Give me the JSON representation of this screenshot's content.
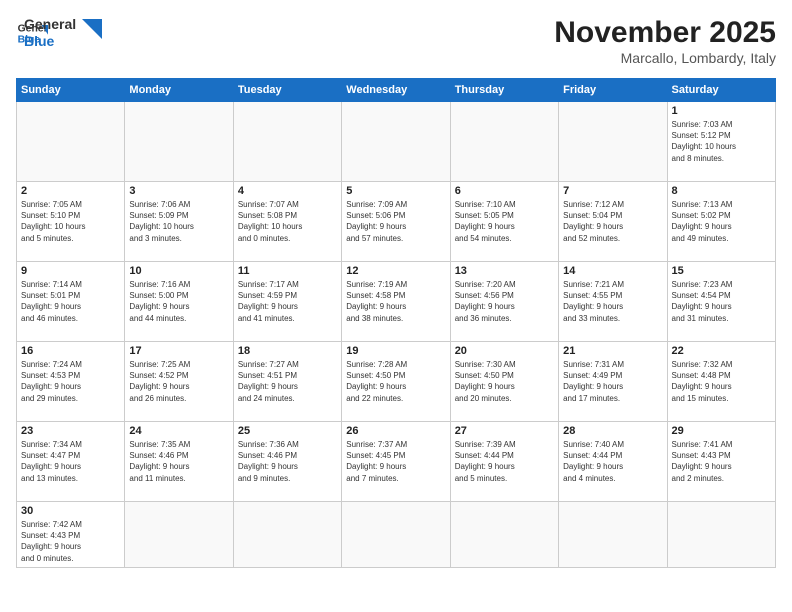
{
  "header": {
    "logo_general": "General",
    "logo_blue": "Blue",
    "month": "November 2025",
    "location": "Marcallo, Lombardy, Italy"
  },
  "weekdays": [
    "Sunday",
    "Monday",
    "Tuesday",
    "Wednesday",
    "Thursday",
    "Friday",
    "Saturday"
  ],
  "weeks": [
    [
      {
        "day": "",
        "info": ""
      },
      {
        "day": "",
        "info": ""
      },
      {
        "day": "",
        "info": ""
      },
      {
        "day": "",
        "info": ""
      },
      {
        "day": "",
        "info": ""
      },
      {
        "day": "",
        "info": ""
      },
      {
        "day": "1",
        "info": "Sunrise: 7:03 AM\nSunset: 5:12 PM\nDaylight: 10 hours\nand 8 minutes."
      }
    ],
    [
      {
        "day": "2",
        "info": "Sunrise: 7:05 AM\nSunset: 5:10 PM\nDaylight: 10 hours\nand 5 minutes."
      },
      {
        "day": "3",
        "info": "Sunrise: 7:06 AM\nSunset: 5:09 PM\nDaylight: 10 hours\nand 3 minutes."
      },
      {
        "day": "4",
        "info": "Sunrise: 7:07 AM\nSunset: 5:08 PM\nDaylight: 10 hours\nand 0 minutes."
      },
      {
        "day": "5",
        "info": "Sunrise: 7:09 AM\nSunset: 5:06 PM\nDaylight: 9 hours\nand 57 minutes."
      },
      {
        "day": "6",
        "info": "Sunrise: 7:10 AM\nSunset: 5:05 PM\nDaylight: 9 hours\nand 54 minutes."
      },
      {
        "day": "7",
        "info": "Sunrise: 7:12 AM\nSunset: 5:04 PM\nDaylight: 9 hours\nand 52 minutes."
      },
      {
        "day": "8",
        "info": "Sunrise: 7:13 AM\nSunset: 5:02 PM\nDaylight: 9 hours\nand 49 minutes."
      }
    ],
    [
      {
        "day": "9",
        "info": "Sunrise: 7:14 AM\nSunset: 5:01 PM\nDaylight: 9 hours\nand 46 minutes."
      },
      {
        "day": "10",
        "info": "Sunrise: 7:16 AM\nSunset: 5:00 PM\nDaylight: 9 hours\nand 44 minutes."
      },
      {
        "day": "11",
        "info": "Sunrise: 7:17 AM\nSunset: 4:59 PM\nDaylight: 9 hours\nand 41 minutes."
      },
      {
        "day": "12",
        "info": "Sunrise: 7:19 AM\nSunset: 4:58 PM\nDaylight: 9 hours\nand 38 minutes."
      },
      {
        "day": "13",
        "info": "Sunrise: 7:20 AM\nSunset: 4:56 PM\nDaylight: 9 hours\nand 36 minutes."
      },
      {
        "day": "14",
        "info": "Sunrise: 7:21 AM\nSunset: 4:55 PM\nDaylight: 9 hours\nand 33 minutes."
      },
      {
        "day": "15",
        "info": "Sunrise: 7:23 AM\nSunset: 4:54 PM\nDaylight: 9 hours\nand 31 minutes."
      }
    ],
    [
      {
        "day": "16",
        "info": "Sunrise: 7:24 AM\nSunset: 4:53 PM\nDaylight: 9 hours\nand 29 minutes."
      },
      {
        "day": "17",
        "info": "Sunrise: 7:25 AM\nSunset: 4:52 PM\nDaylight: 9 hours\nand 26 minutes."
      },
      {
        "day": "18",
        "info": "Sunrise: 7:27 AM\nSunset: 4:51 PM\nDaylight: 9 hours\nand 24 minutes."
      },
      {
        "day": "19",
        "info": "Sunrise: 7:28 AM\nSunset: 4:50 PM\nDaylight: 9 hours\nand 22 minutes."
      },
      {
        "day": "20",
        "info": "Sunrise: 7:30 AM\nSunset: 4:50 PM\nDaylight: 9 hours\nand 20 minutes."
      },
      {
        "day": "21",
        "info": "Sunrise: 7:31 AM\nSunset: 4:49 PM\nDaylight: 9 hours\nand 17 minutes."
      },
      {
        "day": "22",
        "info": "Sunrise: 7:32 AM\nSunset: 4:48 PM\nDaylight: 9 hours\nand 15 minutes."
      }
    ],
    [
      {
        "day": "23",
        "info": "Sunrise: 7:34 AM\nSunset: 4:47 PM\nDaylight: 9 hours\nand 13 minutes."
      },
      {
        "day": "24",
        "info": "Sunrise: 7:35 AM\nSunset: 4:46 PM\nDaylight: 9 hours\nand 11 minutes."
      },
      {
        "day": "25",
        "info": "Sunrise: 7:36 AM\nSunset: 4:46 PM\nDaylight: 9 hours\nand 9 minutes."
      },
      {
        "day": "26",
        "info": "Sunrise: 7:37 AM\nSunset: 4:45 PM\nDaylight: 9 hours\nand 7 minutes."
      },
      {
        "day": "27",
        "info": "Sunrise: 7:39 AM\nSunset: 4:44 PM\nDaylight: 9 hours\nand 5 minutes."
      },
      {
        "day": "28",
        "info": "Sunrise: 7:40 AM\nSunset: 4:44 PM\nDaylight: 9 hours\nand 4 minutes."
      },
      {
        "day": "29",
        "info": "Sunrise: 7:41 AM\nSunset: 4:43 PM\nDaylight: 9 hours\nand 2 minutes."
      }
    ],
    [
      {
        "day": "30",
        "info": "Sunrise: 7:42 AM\nSunset: 4:43 PM\nDaylight: 9 hours\nand 0 minutes."
      },
      {
        "day": "",
        "info": ""
      },
      {
        "day": "",
        "info": ""
      },
      {
        "day": "",
        "info": ""
      },
      {
        "day": "",
        "info": ""
      },
      {
        "day": "",
        "info": ""
      },
      {
        "day": "",
        "info": ""
      }
    ]
  ]
}
